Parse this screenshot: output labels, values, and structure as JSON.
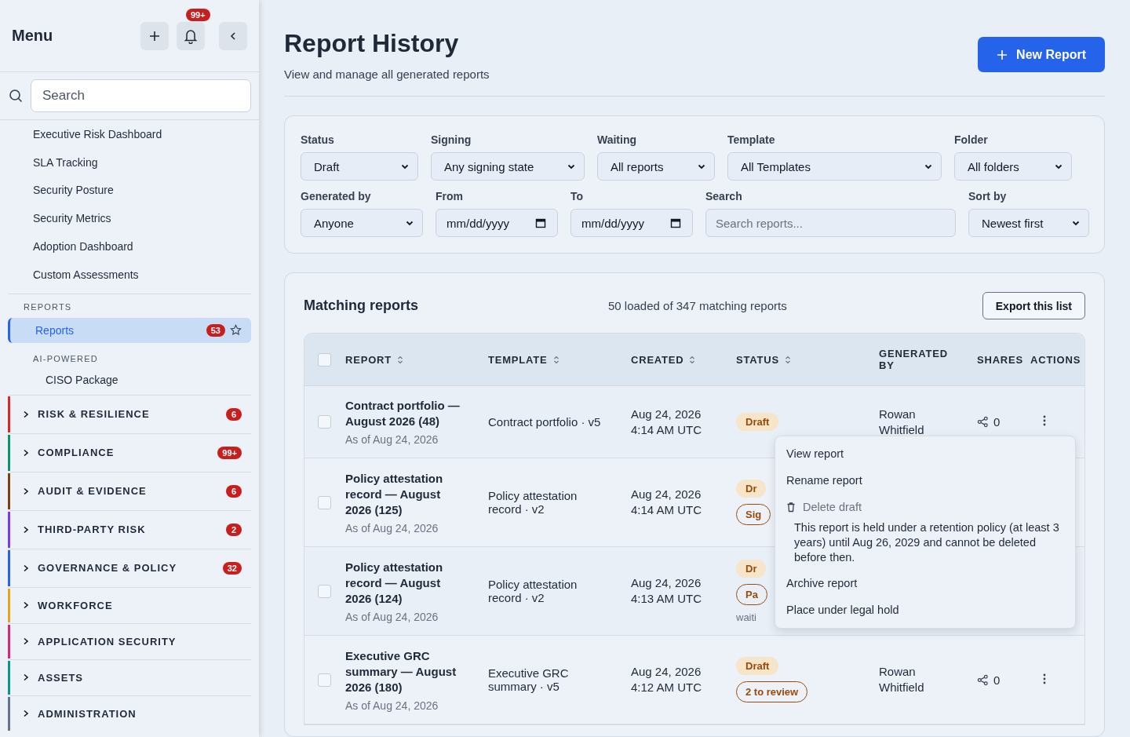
{
  "sidebar": {
    "title": "Menu",
    "notification_badge": "99+",
    "search": {
      "placeholder": "Search"
    },
    "links": [
      "Executive Risk Dashboard",
      "SLA Tracking",
      "Security Posture",
      "Security Metrics",
      "Adoption Dashboard",
      "Custom Assessments"
    ],
    "section": "REPORTS",
    "section_items": [
      {
        "label": "Reports",
        "badge": "53",
        "selected": true
      }
    ],
    "subsection": "AI-POWERED",
    "subsection_items": [
      "CISO Package"
    ],
    "groups": [
      {
        "label": "RISK & RESILIENCE",
        "badge": "6",
        "color": "#dc2626",
        "expanded": false
      },
      {
        "label": "COMPLIANCE",
        "badge": "99+",
        "color": "#059669",
        "expanded": false
      },
      {
        "label": "AUDIT & EVIDENCE",
        "badge": "6",
        "color": "#7c3f12",
        "expanded": false
      },
      {
        "label": "THIRD-PARTY RISK",
        "badge": "2",
        "color": "#7c3aed",
        "expanded": false
      },
      {
        "label": "GOVERNANCE & POLICY",
        "badge": "32",
        "color": "#2563eb",
        "expanded": false
      },
      {
        "label": "WORKFORCE",
        "color": "#e8a317",
        "expanded": false
      },
      {
        "label": "APPLICATION SECURITY",
        "color": "#db2777",
        "expanded": false
      },
      {
        "label": "ASSETS",
        "color": "#0d9488",
        "expanded": false
      },
      {
        "label": "ADMINISTRATION",
        "color": "#64748b",
        "expanded": false
      }
    ]
  },
  "header": {
    "title": "Report History",
    "subtitle": "View and manage all generated reports",
    "new_button": "New Report"
  },
  "filters": [
    [
      {
        "label": "Status",
        "kind": "select",
        "value": "Draft"
      },
      {
        "label": "Signing",
        "kind": "select",
        "value": "Any signing state"
      },
      {
        "label": "Waiting",
        "kind": "select",
        "value": "All reports"
      },
      {
        "label": "Template",
        "kind": "select",
        "value": "All Templates"
      },
      {
        "label": "Folder",
        "kind": "select",
        "value": "All folders"
      }
    ],
    [
      {
        "label": "Generated by",
        "kind": "select",
        "value": "Anyone"
      },
      {
        "label": "From",
        "kind": "date",
        "value": "mm/dd/yyyy"
      },
      {
        "label": "To",
        "kind": "date",
        "value": "mm/dd/yyyy"
      },
      {
        "label": "Search",
        "kind": "search",
        "placeholder": "Search reports..."
      },
      {
        "label": "Sort by",
        "kind": "select",
        "value": "Newest first"
      }
    ]
  ],
  "table": {
    "title": "Matching reports",
    "count": "50 loaded of 347 matching reports",
    "export_button": "Export this list",
    "select_all_checked": false,
    "columns": [
      {
        "label": "REPORT",
        "sortable": true
      },
      {
        "label": "TEMPLATE",
        "sortable": true
      },
      {
        "label": "CREATED",
        "sortable": true
      },
      {
        "label": "STATUS",
        "sortable": true
      },
      {
        "label": "GENERATED BY"
      },
      {
        "label": "SHARES"
      },
      {
        "label": "ACTIONS"
      }
    ],
    "rows": [
      {
        "checked": false,
        "title": "Contract portfolio — August 2026 (48)",
        "as_of": "As of Aug 24, 2026",
        "template": "Contract portfolio · v5",
        "created_date": "Aug 24, 2026",
        "created_time": "4:14 AM UTC",
        "status": "Draft",
        "generated_by": "Rowan Whitfield",
        "shares": "0"
      },
      {
        "checked": false,
        "title": "Policy attestation record — August 2026 (125)",
        "as_of": "As of Aug 24, 2026",
        "template": "Policy attestation record · v2",
        "created_date": "Aug 24, 2026",
        "created_time": "4:14 AM UTC",
        "status": "Dr",
        "tag": "Sig"
      },
      {
        "checked": false,
        "title": "Policy attestation record — August 2026 (124)",
        "as_of": "As of Aug 24, 2026",
        "template": "Policy attestation record · v2",
        "created_date": "Aug 24, 2026",
        "created_time": "4:13 AM UTC",
        "status": "Dr",
        "tag": "Pa",
        "note": "waiti"
      },
      {
        "checked": false,
        "title": "Executive GRC summary — August 2026 (180)",
        "as_of": "As of Aug 24, 2026",
        "template": "Executive GRC summary · v5",
        "created_date": "Aug 24, 2026",
        "created_time": "4:12 AM UTC",
        "status": "Draft",
        "tag": "2 to review",
        "generated_by": "Rowan Whitfield",
        "shares": "0"
      }
    ]
  },
  "row_menu": {
    "items": [
      {
        "label": "View report",
        "disabled": false
      },
      {
        "label": "Rename report",
        "disabled": false
      },
      {
        "label": "Delete draft",
        "disabled": true,
        "note": "This report is held under a retention policy (at least 3 years) until Aug 26, 2029 and cannot be deleted before then."
      },
      {
        "label": "Archive report",
        "disabled": false
      },
      {
        "label": "Place under legal hold",
        "disabled": false
      }
    ]
  }
}
